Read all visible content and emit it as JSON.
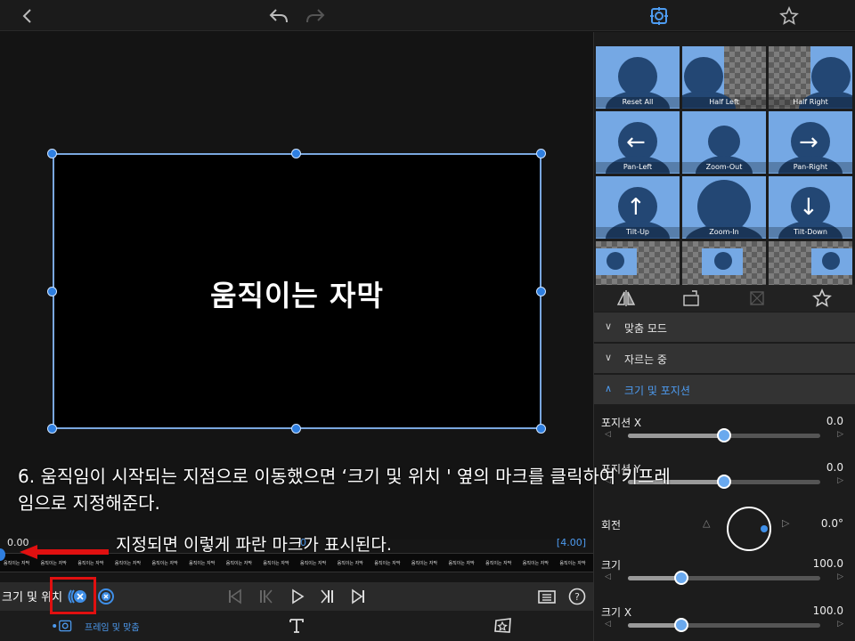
{
  "topbar": {
    "back_icon": "chevron-left-icon",
    "undo_icon": "undo-icon",
    "redo_icon": "redo-icon",
    "transform_icon": "transform-target-icon",
    "favorite_icon": "star-icon"
  },
  "preview": {
    "caption": "움직이는 자막"
  },
  "annotation": {
    "instruction_line1": "6. 움직임이 시작되는 지점으로 이동했으면 ‘크기 및 위치 ' 옆의 마크를 클릭하여 키프레",
    "instruction_line2": "임으로 지정해준다.",
    "note": "지정되면 이렇게 파란 마크가 표시된다."
  },
  "timeline": {
    "start_time": "0.00",
    "mid_time": "0",
    "end_time": "[4.00]",
    "cells": [
      "움직이는 자막",
      "움직이는 자막",
      "움직이는 자막",
      "움직이는 자막",
      "움직이는 자막",
      "움직이는 자막",
      "움직이는 자막",
      "움직이는 자막",
      "움직이는 자막",
      "움직이는 자막",
      "움직이는 자막",
      "움직이는 자막",
      "움직이는 자막",
      "움직이는 자막",
      "움직이는 자막",
      "움직이는 자막"
    ]
  },
  "keyframe_row": {
    "label": "크기 및 위치"
  },
  "bottom_tabs": {
    "frame_fit": "프레임 및 맞춤"
  },
  "presets": [
    {
      "label": "Reset All"
    },
    {
      "label": "Half Left"
    },
    {
      "label": "Half Right"
    },
    {
      "label": "Pan-Left"
    },
    {
      "label": "Zoom-Out"
    },
    {
      "label": "Pan-Right"
    },
    {
      "label": "Tilt-Up"
    },
    {
      "label": "Zoom-In"
    },
    {
      "label": "Tilt-Down"
    }
  ],
  "sections": {
    "fit_mode": "맞춤 모드",
    "cropping": "자르는 중",
    "size_position": "크기 및 포지션"
  },
  "properties": {
    "position_x": {
      "name": "포지션 X",
      "value": "0.0",
      "fraction": 0.5
    },
    "position_y": {
      "name": "포지션 Y",
      "value": "0.0",
      "fraction": 0.5
    },
    "rotation": {
      "name": "회전",
      "value": "0.0°"
    },
    "scale": {
      "name": "크기",
      "value": "100.0",
      "fraction": 0.28
    },
    "scale_x": {
      "name": "크기 X",
      "value": "100.0",
      "fraction": 0.28
    }
  },
  "colors": {
    "accent": "#4d9bf0",
    "annotation_red": "#e01010"
  }
}
